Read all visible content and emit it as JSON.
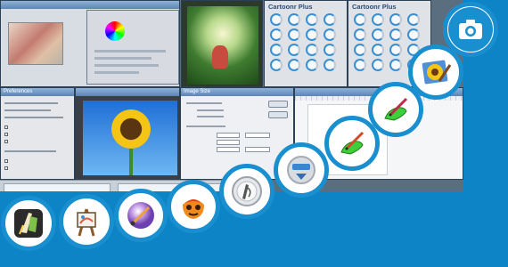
{
  "collage": {
    "photo_editor": {
      "label": "photo editor with color dialog"
    },
    "cartoonr_1": {
      "title": "Cartoonr Plus"
    },
    "cartoonr_2": {
      "title": "Cartoonr Plus"
    },
    "preferences": {
      "title": "Preferences"
    },
    "image_size": {
      "title": "Image Size"
    }
  },
  "icons": [
    {
      "name": "artrage-pen-icon"
    },
    {
      "name": "easel-painting-icon"
    },
    {
      "name": "color-brush-orb-icon"
    },
    {
      "name": "flame-mask-icon"
    },
    {
      "name": "pen-tablet-button-icon"
    },
    {
      "name": "blue-download-disc-icon"
    },
    {
      "name": "green-hand-pencil-icon"
    },
    {
      "name": "green-hand-brush-icon"
    },
    {
      "name": "sunflower-paint-icon"
    },
    {
      "name": "camera-icon"
    }
  ],
  "colors": {
    "background": "#0d84c6",
    "badge_ring": "#1a8fd0",
    "icon_green": "#3ecf3a"
  }
}
